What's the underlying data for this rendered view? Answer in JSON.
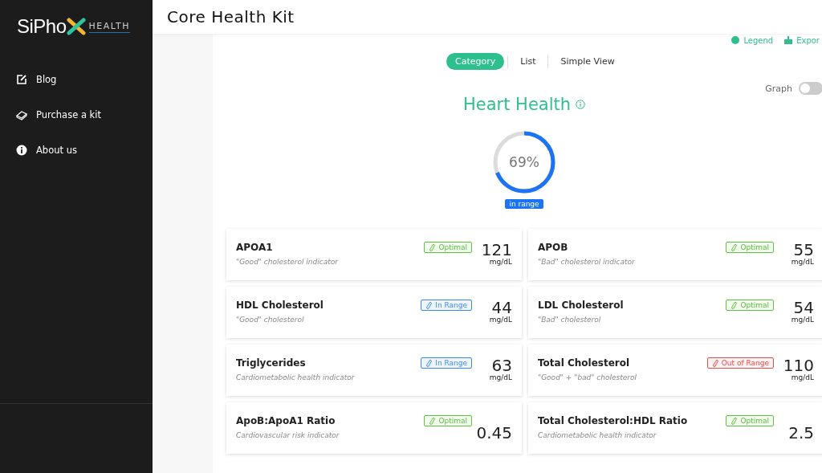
{
  "sidebar": {
    "logo": {
      "name": "SiPho",
      "suffix": "HEALTH"
    },
    "items": [
      {
        "label": "Blog",
        "kind": "edit"
      },
      {
        "label": "Purchase a kit",
        "kind": "kit"
      },
      {
        "label": "About us",
        "kind": "info"
      }
    ]
  },
  "header": {
    "title": "Core Health Kit"
  },
  "toolbar": {
    "links": [
      {
        "label": "Legend",
        "kind": "legend"
      },
      {
        "label": "Expor",
        "kind": "export"
      }
    ]
  },
  "view_tabs": [
    {
      "label": "Category",
      "selected": true
    },
    {
      "label": "List",
      "selected": false
    },
    {
      "label": "Simple View",
      "selected": false
    }
  ],
  "graph_toggle": {
    "label": "Graph",
    "on": false
  },
  "category": {
    "title": "Heart Health",
    "percent": "69%",
    "level": 0.69,
    "badge": "in range"
  },
  "markers": [
    {
      "name": "APOA1",
      "description": "\"Good\" cholesterol indicator",
      "status": "Optimal",
      "kind": "optimal",
      "value": "121",
      "unit": "mg/dL"
    },
    {
      "name": "APOB",
      "description": "\"Bad\" cholesterol indicator",
      "status": "Optimal",
      "kind": "optimal",
      "value": "55",
      "unit": "mg/dL"
    },
    {
      "name": "HDL Cholesterol",
      "description": "\"Good\" cholesterol",
      "status": "In Range",
      "kind": "in_range",
      "value": "44",
      "unit": "mg/dL"
    },
    {
      "name": "LDL Cholesterol",
      "description": "\"Bad\" cholesterol",
      "status": "Optimal",
      "kind": "optimal",
      "value": "54",
      "unit": "mg/dL"
    },
    {
      "name": "Triglycerides",
      "description": "Cardiometabolic health indicator",
      "status": "In Range",
      "kind": "in_range",
      "value": "63",
      "unit": "mg/dL"
    },
    {
      "name": "Total Cholesterol",
      "description": "\"Good\" + \"bad\" cholesterol",
      "status": "Out of Range",
      "kind": "out_of_range",
      "value": "110",
      "unit": "mg/dL"
    },
    {
      "name": "ApoB:ApoA1 Ratio",
      "description": "Cardiovascular risk indicator",
      "status": "Optimal",
      "kind": "optimal",
      "value": "0.45"
    },
    {
      "name": "Total Cholesterol:HDL Ratio",
      "description": "Cardiometabolic health indicator",
      "status": "Optimal",
      "kind": "optimal",
      "value": "2.5"
    }
  ]
}
